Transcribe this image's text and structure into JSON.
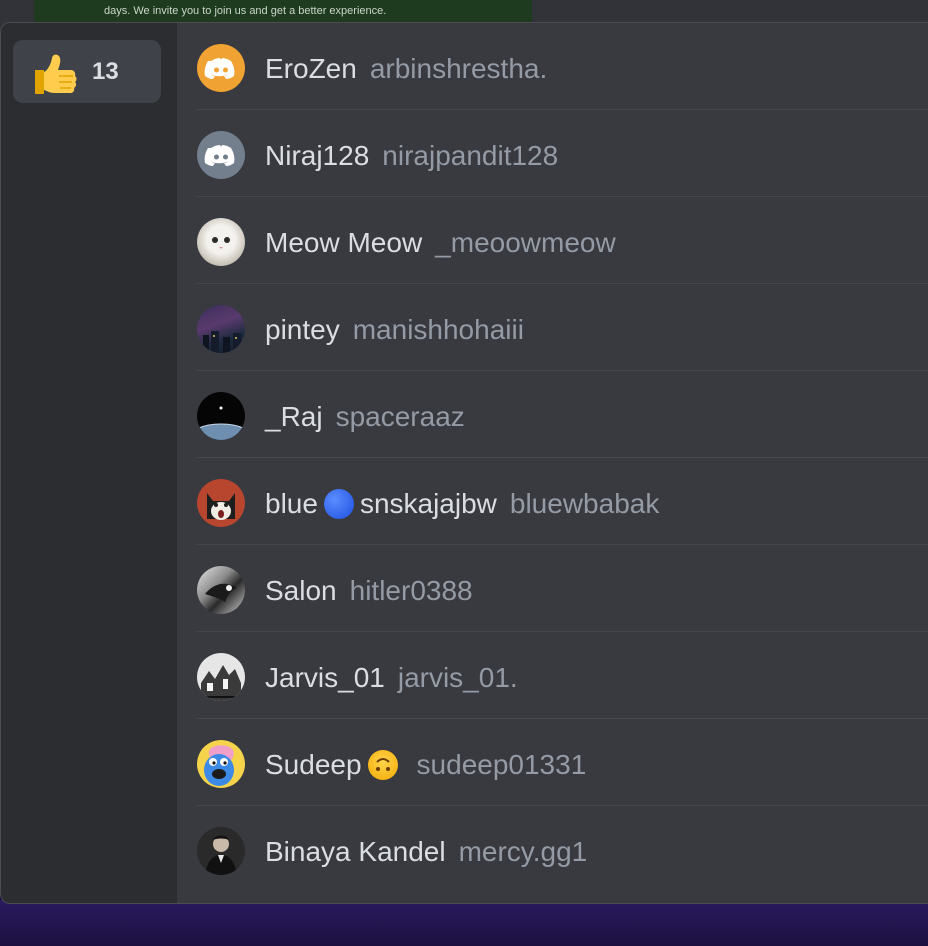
{
  "background": {
    "banner_text": "days. We invite you to join us and get a better experience."
  },
  "reaction": {
    "emoji": "thumbs-up-icon",
    "count": "13"
  },
  "users": [
    {
      "display": "EroZen",
      "username": "arbinshrestha.",
      "avatar": "discord-logo-orange"
    },
    {
      "display": "Niraj128",
      "username": "nirajpandit128",
      "avatar": "discord-logo-grey"
    },
    {
      "display": "Meow Meow",
      "username": "_meoowmeow",
      "avatar": "white-cat-photo"
    },
    {
      "display": "pintey",
      "username": "manishhohaiii",
      "avatar": "night-city-photo"
    },
    {
      "display": "_Raj",
      "username": "spaceraaz",
      "avatar": "earth-from-space-photo"
    },
    {
      "display_before": "blue",
      "display_emoji": "blue-circle-emoji",
      "display_after": "snskajajbw",
      "username": "bluewbabak",
      "avatar": "cartoon-cat-photo"
    },
    {
      "display": "Salon",
      "username": "hitler0388",
      "avatar": "monochrome-art-photo"
    },
    {
      "display": "Jarvis_01",
      "username": "jarvis_01.",
      "avatar": "manga-art-photo"
    },
    {
      "display_before": "Sudeep",
      "display_emoji": "upside-down-face-emoji",
      "username": "sudeep01331",
      "avatar": "blue-cartoon-character"
    },
    {
      "display": "Binaya Kandel",
      "username": "mercy.gg1",
      "avatar": "man-in-suit-photo"
    }
  ],
  "colors": {
    "modal_bg": "#383a40",
    "sidebar_bg": "#2b2d31",
    "name_text": "#dbdee1",
    "username_text": "#949ba4",
    "discord_orange": "#f0a232",
    "discord_grey": "#747f8d"
  }
}
